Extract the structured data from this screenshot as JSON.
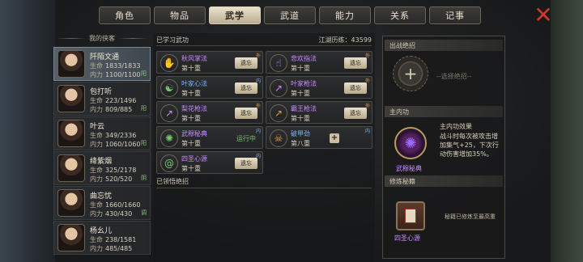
{
  "tabs": [
    {
      "label": "角色",
      "active": false
    },
    {
      "label": "物品",
      "active": false
    },
    {
      "label": "武学",
      "active": true
    },
    {
      "label": "武道",
      "active": false
    },
    {
      "label": "能力",
      "active": false
    },
    {
      "label": "关系",
      "active": false
    },
    {
      "label": "记事",
      "active": false
    }
  ],
  "close_icon": "close-x-icon",
  "list_header": "我的侠客",
  "heroes": [
    {
      "name": "阡陌文通",
      "hp_label": "生命",
      "hp": "1833/1833",
      "mp_label": "内力",
      "mp": "1100/1100",
      "tag": "阳",
      "selected": true
    },
    {
      "name": "包打听",
      "hp_label": "生命",
      "hp": "223/1496",
      "mp_label": "内力",
      "mp": "809/885",
      "tag": "阳",
      "selected": false
    },
    {
      "name": "叶云",
      "hp_label": "生命",
      "hp": "349/2336",
      "mp_label": "内力",
      "mp": "1060/1060",
      "tag": "阳",
      "selected": false
    },
    {
      "name": "绛紫烟",
      "hp_label": "生命",
      "hp": "325/2178",
      "mp_label": "内力",
      "mp": "520/520",
      "tag": "阴",
      "selected": false
    },
    {
      "name": "曲忘忧",
      "hp_label": "生命",
      "hp": "1660/1660",
      "mp_label": "内力",
      "mp": "430/430",
      "tag": "调",
      "selected": false
    },
    {
      "name": "杨幺儿",
      "hp_label": "生命",
      "hp": "238/1581",
      "mp_label": "内力",
      "mp": "485/485",
      "tag": "",
      "selected": false
    }
  ],
  "learned_title": "已学习武功",
  "experience": "江湖历练：43599",
  "skills": [
    {
      "name": "秋风掌法",
      "level": "第十重",
      "action": "遗忘",
      "corner": "外",
      "color": "purple",
      "icon": "palm-icon"
    },
    {
      "name": "悲欢指法",
      "level": "第十重",
      "action": "遗忘",
      "corner": "外",
      "color": "purple",
      "icon": "finger-icon"
    },
    {
      "name": "叶家心法",
      "level": "第十重",
      "action": "遗忘",
      "corner": "内",
      "color": "blue",
      "icon": "meditation-icon"
    },
    {
      "name": "叶家枪法",
      "level": "第十重",
      "action": "遗忘",
      "corner": "外",
      "color": "purple",
      "icon": "spear-icon"
    },
    {
      "name": "梨花枪法",
      "level": "第十重",
      "action": "遗忘",
      "corner": "外",
      "color": "purple",
      "icon": "spear-icon"
    },
    {
      "name": "霸王枪法",
      "level": "第十重",
      "action": "遗忘",
      "corner": "外",
      "color": "purple",
      "icon": "spear-icon"
    },
    {
      "name": "武穆秘典",
      "level": "第十重",
      "action": "运行中",
      "corner": "内",
      "color": "purple",
      "icon": "claw-icon"
    },
    {
      "name": "破甲劲",
      "level": "第八重",
      "action": "",
      "corner": "内",
      "color": "blue",
      "icon": "armor-break-icon",
      "plus": "+"
    },
    {
      "name": "四圣心源",
      "level": "第十重",
      "action": "遗忘",
      "corner": "内",
      "color": "purple",
      "icon": "swirl-icon"
    }
  ],
  "unlearned_title": "已领悟绝招",
  "right": {
    "ultimate_title": "出战绝招",
    "ultimate_plus": "+",
    "select_hint": "--选择绝招--",
    "inner_title": "主内功",
    "inner_name": "武穆秘典",
    "effect_title": "主内功效果",
    "effect_text": "战斗时每次被攻击增加集气+25，下次行动伤害增加35%。",
    "book_title": "修炼秘籍",
    "book_name": "四圣心源",
    "book_hint": "秘籍已修炼至最高重"
  }
}
